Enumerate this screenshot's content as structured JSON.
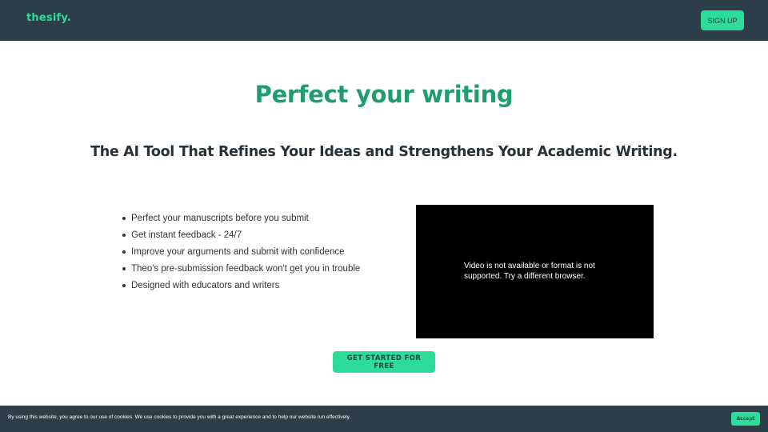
{
  "header": {
    "logo_text": "thesify.",
    "signup_label": "SIGN UP"
  },
  "hero": {
    "title": "Perfect your writing",
    "subtitle": "The AI Tool That Refines Your Ideas and Strengthens Your Academic Writing."
  },
  "features": {
    "items": [
      "Perfect your manuscripts before you submit",
      "Get instant feedback - 24/7",
      "Improve your arguments and submit with confidence",
      "Theo's pre-submission feedback won't get you in trouble",
      "Designed with educators and writers"
    ]
  },
  "video": {
    "message": "Video is not available or format is not supported. Try a different browser."
  },
  "cta": {
    "label": "GET STARTED FOR FREE"
  },
  "cookie": {
    "text": "By using this website, you agree to our use of cookies. We use cookies to provide you with a great experience and to help our website run effectively.",
    "accept_label": "Accept"
  },
  "colors": {
    "accent": "#2ddc9a",
    "title_green": "#1f9d6e",
    "nav_bg": "#2c3e47"
  }
}
